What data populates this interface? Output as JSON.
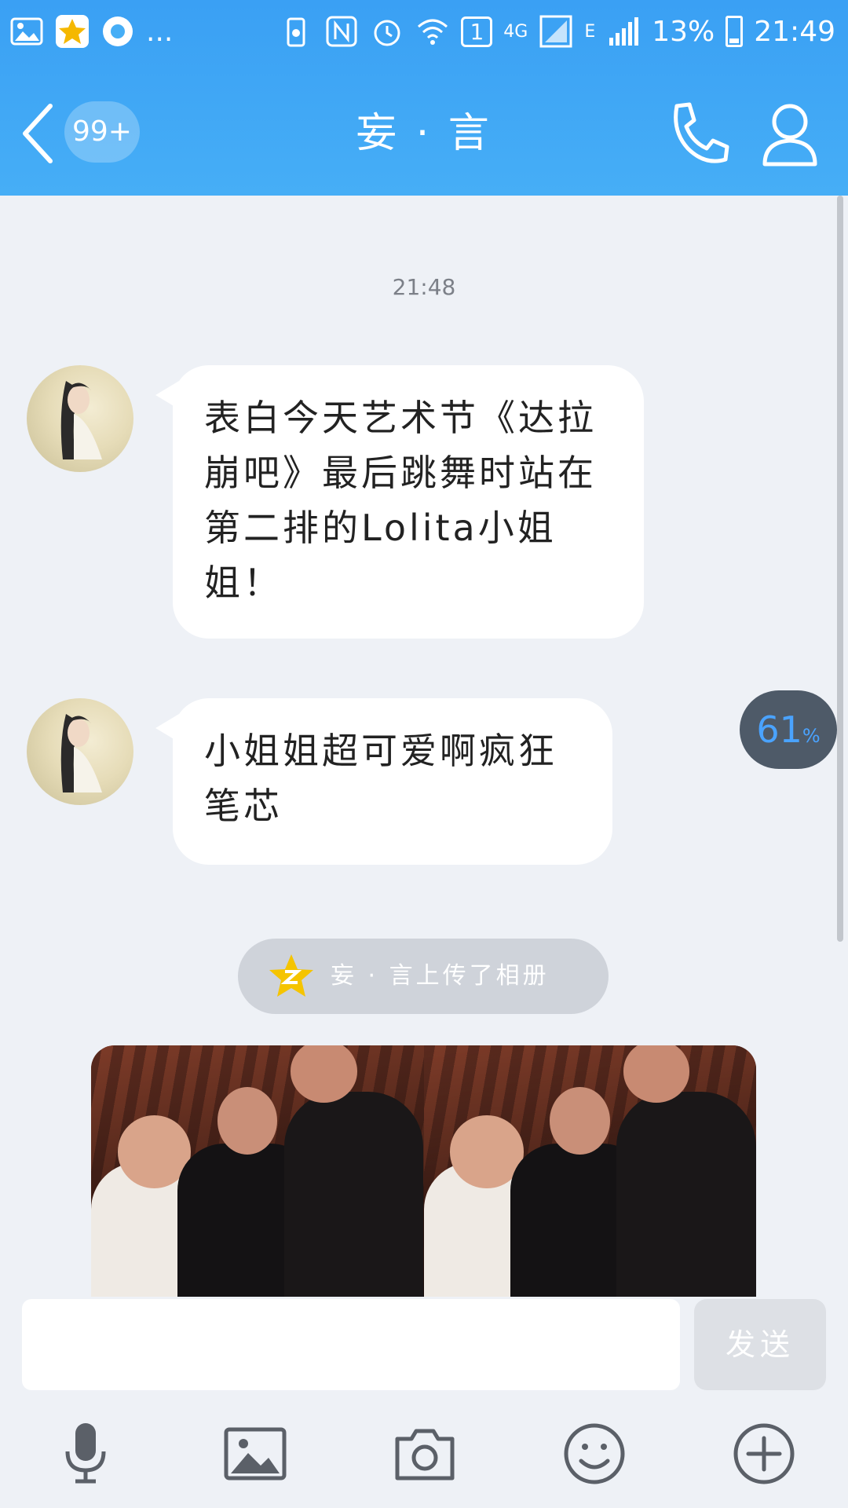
{
  "status_bar": {
    "more": "...",
    "sim_badge": "1",
    "network_4g": "4G",
    "network_e": "E",
    "battery": "13%",
    "time": "21:49"
  },
  "header": {
    "unread_badge": "99+",
    "title": "妄 · 言"
  },
  "chat": {
    "timestamp": "21:48",
    "messages": [
      {
        "text": "表白今天艺术节《达拉崩吧》最后跳舞时站在第二排的Lolita小姐姐！"
      },
      {
        "text": "小姐姐超可爱啊疯狂笔芯"
      }
    ],
    "read_indicator": {
      "value": "61",
      "unit": "%"
    },
    "album_notice": "妄 · 言上传了相册"
  },
  "input": {
    "placeholder": "",
    "send_label": "发送"
  },
  "colors": {
    "header_blue": "#3aa0f4",
    "chat_bg": "#eef1f6",
    "bubble": "#ffffff",
    "read_pill": "#4e5a68",
    "read_text": "#4aa3ff"
  },
  "toolbar_icons": [
    "microphone-icon",
    "image-icon",
    "camera-icon",
    "emoji-icon",
    "plus-icon"
  ]
}
